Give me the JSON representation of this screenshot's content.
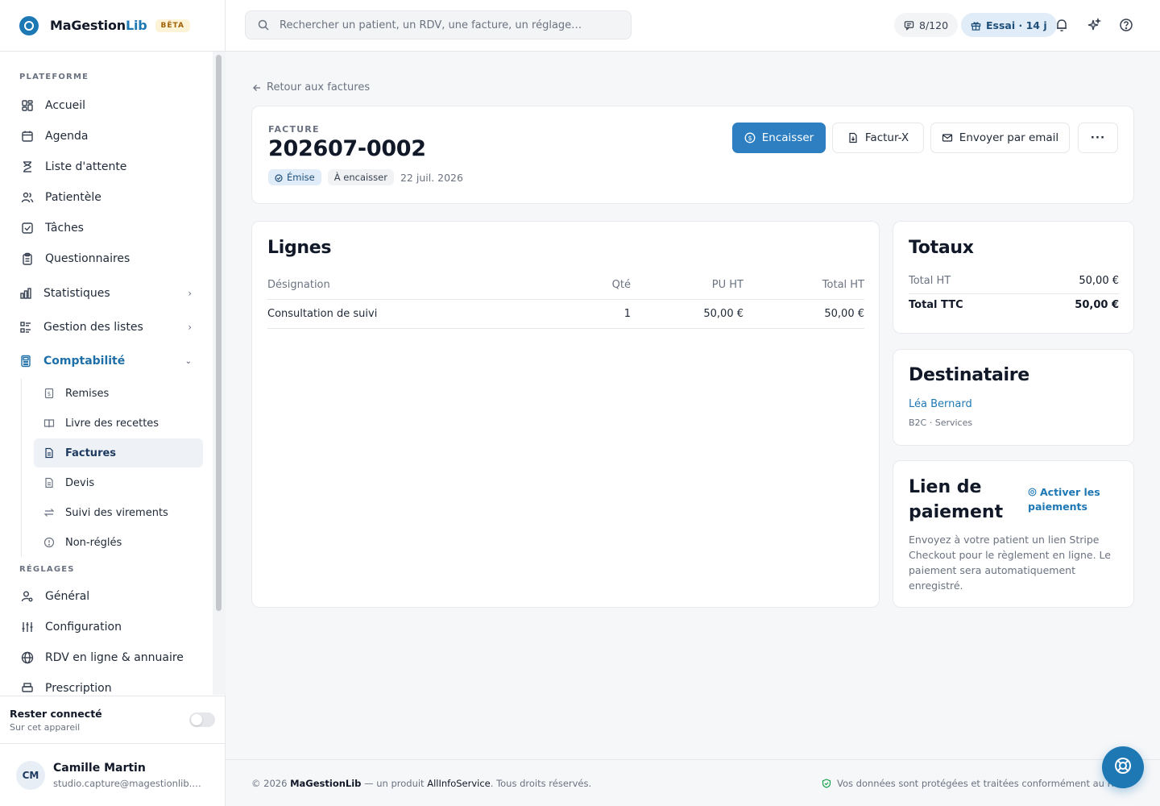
{
  "brand": {
    "name_main": "MaGestion",
    "name_accent": "Lib",
    "badge": "BÊTA"
  },
  "search": {
    "placeholder": "Rechercher un patient, un RDV, une facture, un réglage…"
  },
  "topbar": {
    "quota": "8/120",
    "trial": "Essai · 14 j"
  },
  "sidebar": {
    "section_platform": "PLATEFORME",
    "items": [
      {
        "label": "Accueil",
        "icon": "dashboard-icon"
      },
      {
        "label": "Agenda",
        "icon": "calendar-icon"
      },
      {
        "label": "Liste d'attente",
        "icon": "hourglass-icon"
      },
      {
        "label": "Patientèle",
        "icon": "users-icon"
      },
      {
        "label": "Tâches",
        "icon": "checkbox-icon"
      },
      {
        "label": "Questionnaires",
        "icon": "clipboard-icon"
      },
      {
        "label": "Statistiques",
        "icon": "chart-icon"
      },
      {
        "label": "Gestion des listes",
        "icon": "list-icon"
      },
      {
        "label": "Comptabilité",
        "icon": "calculator-icon"
      }
    ],
    "sub_items": [
      {
        "label": "Remises",
        "icon": "receipt-icon"
      },
      {
        "label": "Livre des recettes",
        "icon": "book-icon"
      },
      {
        "label": "Factures",
        "icon": "file-icon"
      },
      {
        "label": "Devis",
        "icon": "file-icon"
      },
      {
        "label": "Suivi des virements",
        "icon": "transfer-icon"
      },
      {
        "label": "Non-réglés",
        "icon": "alert-circle-icon"
      }
    ],
    "section_settings": "RÉGLAGES",
    "settings_items": [
      {
        "label": "Général",
        "icon": "user-gear-icon"
      },
      {
        "label": "Configuration",
        "icon": "sliders-icon"
      },
      {
        "label": "RDV en ligne & annuaire",
        "icon": "globe-icon"
      },
      {
        "label": "Prescription",
        "icon": "print-icon"
      }
    ]
  },
  "stay_connected": {
    "title": "Rester connecté",
    "subtitle": "Sur cet appareil"
  },
  "user": {
    "initials": "CM",
    "name": "Camille Martin",
    "email": "studio.capture@magestionlib.com"
  },
  "main": {
    "back_label": "Retour aux factures",
    "invoice": {
      "label": "FACTURE",
      "number": "202607-0002",
      "status": "Émise",
      "payment_status": "À encaisser",
      "date": "22 juil. 2026"
    },
    "actions": {
      "collect": "Encaisser",
      "facturx": "Factur-X",
      "email": "Envoyer par email",
      "more": "···"
    },
    "lines": {
      "title": "Lignes",
      "headers": [
        "Désignation",
        "Qté",
        "PU HT",
        "Total HT"
      ],
      "rows": [
        {
          "designation": "Consultation de suivi",
          "qty": "1",
          "unit": "50,00 €",
          "total": "50,00 €"
        }
      ]
    },
    "totals": {
      "title": "Totaux",
      "ht_label": "Total HT",
      "ht_value": "50,00 €",
      "ttc_label": "Total TTC",
      "ttc_value": "50,00 €"
    },
    "recipient": {
      "title": "Destinataire",
      "name": "Léa Bernard",
      "meta": "B2C · Services"
    },
    "payment_link": {
      "title": "Lien de paiement",
      "activate": "Activer les paiements",
      "description": "Envoyez à votre patient un lien Stripe Checkout pour le règlement en ligne. Le paiement sera automatiquement enregistré."
    }
  },
  "footer": {
    "copyright": "© 2026",
    "brand": "MaGestionLib",
    "middle": "— un produit",
    "company": "AllInfoService",
    "rights": ". Tous droits réservés.",
    "privacy": "Vos données sont protégées et traitées conformément au RGPD"
  },
  "colors": {
    "accent": "#1e78b4",
    "primary_button": "#2d7fc1",
    "badge_bg": "#e0ecf7"
  }
}
